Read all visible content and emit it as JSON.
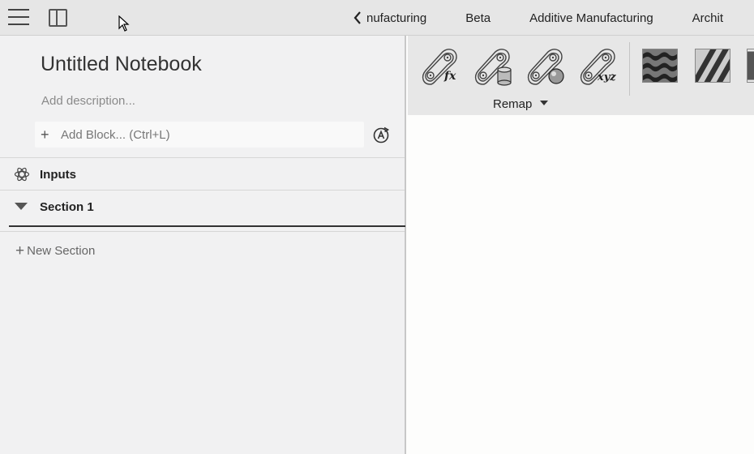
{
  "topbar": {
    "tabs": [
      {
        "label": "nufacturing"
      },
      {
        "label": "Beta"
      },
      {
        "label": "Additive Manufacturing"
      },
      {
        "label": "Archit"
      }
    ]
  },
  "notebook": {
    "title": "Untitled Notebook",
    "description_placeholder": "Add description...",
    "add_block_label": "Add Block... (Ctrl+L)",
    "inputs_label": "Inputs",
    "section_label": "Section 1",
    "new_section_label": "New Section"
  },
  "ribbon": {
    "group_label": "Remap",
    "icons": [
      "remap-fx-icon",
      "remap-cylinder-icon",
      "remap-sphere-icon",
      "remap-xyz-icon"
    ],
    "textures": [
      "wavy-texture-icon",
      "stripe-texture-icon",
      "texture-partial-icon"
    ],
    "fx_text": "fx",
    "xyz_text": "xyz"
  }
}
